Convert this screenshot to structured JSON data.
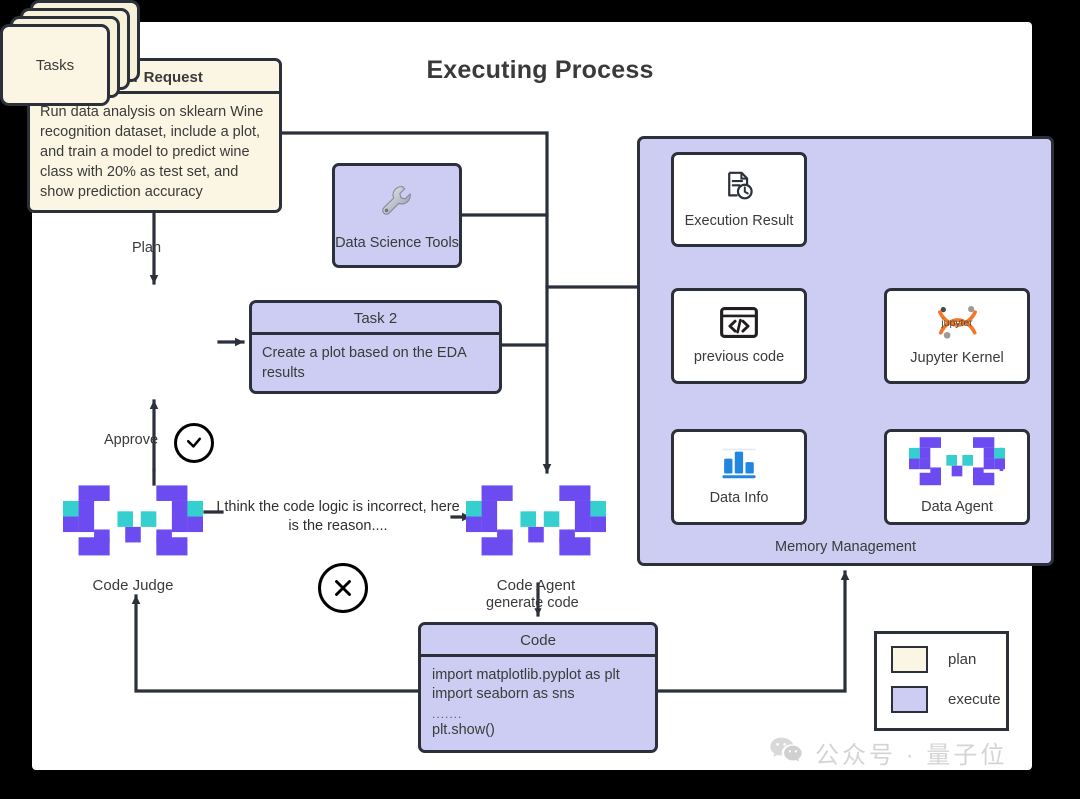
{
  "diagram": {
    "title": "Executing Process"
  },
  "user_request": {
    "header": "User Request",
    "body": "Run data analysis on sklearn Wine recognition dataset, include a plot, and train a model to predict wine class with 20% as test set, and show prediction accuracy"
  },
  "tools": {
    "label": "Data Science Tools",
    "icon": "wrench-icon"
  },
  "tasks": {
    "label": "Tasks"
  },
  "task2": {
    "header": "Task 2",
    "body": "Create a plot based on the EDA results"
  },
  "code": {
    "header": "Code",
    "line1": "import matplotlib.pyplot as plt",
    "line2": "import seaborn as sns",
    "ellipsis": ".......",
    "line3": "plt.show()"
  },
  "agents": {
    "code_judge": "Code Judge",
    "code_agent": "Code Agent",
    "judge_message": "I think the code logic is incorrect, here is the reason...."
  },
  "memory": {
    "panel_label": "Memory Management",
    "boxes": [
      {
        "label": "Execution Result",
        "icon": "document-clock-icon"
      },
      {
        "label": "previous code",
        "icon": "code-window-icon"
      },
      {
        "label": "Jupyter Kernel",
        "icon": "jupyter-icon"
      },
      {
        "label": "Data Info",
        "icon": "bar-chart-icon"
      },
      {
        "label": "Data Agent",
        "icon": "agent-pixel-icon"
      }
    ]
  },
  "edge_labels": {
    "plan": "Plan",
    "approve": "Approve",
    "generate_code": "generate code",
    "approve_icon": "check-circle-icon",
    "reject_icon": "cross-circle-icon"
  },
  "legend": {
    "items": [
      {
        "label": "plan",
        "color": "#faf6e3"
      },
      {
        "label": "execute",
        "color": "#cdcdf4"
      }
    ]
  },
  "watermark": {
    "text": "公众号 · 量子位",
    "icon": "wechat-icon"
  },
  "colors": {
    "plan": "#faf6e3",
    "execute": "#cdcdf4",
    "stroke": "#2b303b",
    "accent_purple": "#6c4cf0",
    "accent_teal": "#35cfd0",
    "jupyter_orange": "#f37726",
    "chart_blue": "#2186e0",
    "canvas": "#ffffff",
    "background": "#000000"
  }
}
